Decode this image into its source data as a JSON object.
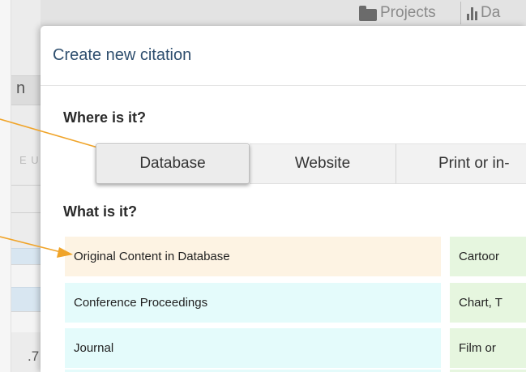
{
  "background": {
    "nav": {
      "projects_label": "Projects",
      "second_label": "Da"
    },
    "left_tab_letter": "n",
    "faded_text": "E U",
    "row_number": ".7"
  },
  "modal": {
    "title": "Create new citation",
    "where_label": "Where is it?",
    "source_tabs": [
      {
        "label": "Database",
        "active": true
      },
      {
        "label": "Website",
        "active": false
      },
      {
        "label": "Print or in-",
        "active": false
      }
    ],
    "what_label": "What is it?",
    "types_left": [
      {
        "label": "Original Content in Database"
      },
      {
        "label": "Conference Proceedings"
      },
      {
        "label": "Journal"
      }
    ],
    "types_right": [
      {
        "label": "Cartoor"
      },
      {
        "label": "Chart, T"
      },
      {
        "label": "Film or "
      }
    ]
  },
  "colors": {
    "title_color": "#2f4f6f",
    "highlight_orange": "#fdf3e3",
    "item_cyan": "#e4fbfb",
    "item_green": "#e6f6df",
    "arrow_orange": "#f0a429"
  },
  "icons": {
    "projects": "folder-icon",
    "chart": "bar-chart-icon"
  }
}
